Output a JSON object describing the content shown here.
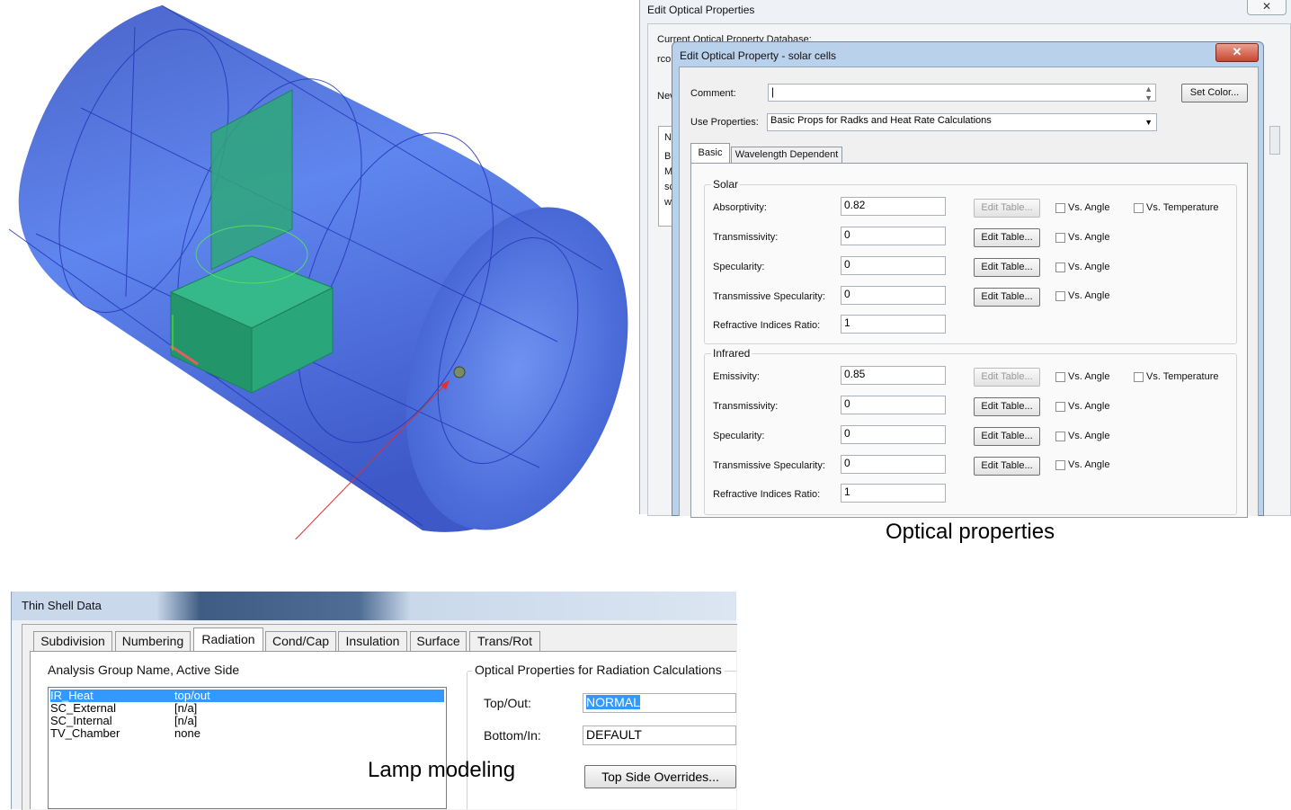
{
  "captions": {
    "optical": "Optical properties",
    "lamp": "Lamp modeling"
  },
  "outer_dialog": {
    "title": "Edit Optical Properties",
    "close_glyph": "✕",
    "db_label": "Current Optical Property Database:",
    "frag_rco": "rco",
    "frag_new": "Nev",
    "list_frags": [
      "N",
      "Bl",
      "M",
      "sc",
      "w"
    ]
  },
  "inner_dialog": {
    "title": "Edit Optical Property - solar cells",
    "close_glyph": "✕",
    "comment_label": "Comment:",
    "comment_value": "|",
    "set_color_label": "Set Color...",
    "use_props_label": "Use Properties:",
    "use_props_value": "Basic Props for Radks and Heat Rate Calculations",
    "tabs": [
      "Basic",
      "Wavelength Dependent"
    ],
    "solar": {
      "group_label": "Solar",
      "rows": [
        {
          "label": "Absorptivity:",
          "value": "0.82",
          "btn": "Edit Table...",
          "btn_enabled": false,
          "angle": "Vs. Angle",
          "temp": "Vs. Temperature"
        },
        {
          "label": "Transmissivity:",
          "value": "0",
          "btn": "Edit Table...",
          "btn_enabled": true,
          "angle": "Vs. Angle"
        },
        {
          "label": "Specularity:",
          "value": "0",
          "btn": "Edit Table...",
          "btn_enabled": true,
          "angle": "Vs. Angle"
        },
        {
          "label": "Transmissive Specularity:",
          "value": "0",
          "btn": "Edit Table...",
          "btn_enabled": true,
          "angle": "Vs. Angle"
        },
        {
          "label": "Refractive Indices Ratio:",
          "value": "1"
        }
      ]
    },
    "infrared": {
      "group_label": "Infrared",
      "rows": [
        {
          "label": "Emissivity:",
          "value": "0.85",
          "btn": "Edit Table...",
          "btn_enabled": false,
          "angle": "Vs. Angle",
          "temp": "Vs. Temperature"
        },
        {
          "label": "Transmissivity:",
          "value": "0",
          "btn": "Edit Table...",
          "btn_enabled": true,
          "angle": "Vs. Angle"
        },
        {
          "label": "Specularity:",
          "value": "0",
          "btn": "Edit Table...",
          "btn_enabled": true,
          "angle": "Vs. Angle"
        },
        {
          "label": "Transmissive Specularity:",
          "value": "0",
          "btn": "Edit Table...",
          "btn_enabled": true,
          "angle": "Vs. Angle"
        },
        {
          "label": "Refractive Indices Ratio:",
          "value": "1"
        }
      ]
    }
  },
  "thin_shell": {
    "title": "Thin Shell Data",
    "tabs": [
      "Subdivision",
      "Numbering",
      "Radiation",
      "Cond/Cap",
      "Insulation",
      "Surface",
      "Trans/Rot"
    ],
    "active_tab": "Radiation",
    "analysis_label": "Analysis Group Name, Active Side",
    "groups": [
      {
        "name": "IR_Heat",
        "side": "top/out",
        "selected": true
      },
      {
        "name": "SC_External",
        "side": "[n/a]",
        "selected": false
      },
      {
        "name": "SC_Internal",
        "side": "[n/a]",
        "selected": false
      },
      {
        "name": "TV_Chamber",
        "side": "none",
        "selected": false
      }
    ],
    "optical_label": "Optical Properties for Radiation Calculations",
    "top_out_label": "Top/Out:",
    "top_out_value": "NORMAL",
    "bottom_in_label": "Bottom/In:",
    "bottom_in_value": "DEFAULT",
    "overrides_label": "Top Side Overrides..."
  },
  "colors": {
    "cylinder": "#4a6ee0",
    "panel": "#2ea87a",
    "selection": "#3399ff",
    "annotation": "#e03030"
  }
}
